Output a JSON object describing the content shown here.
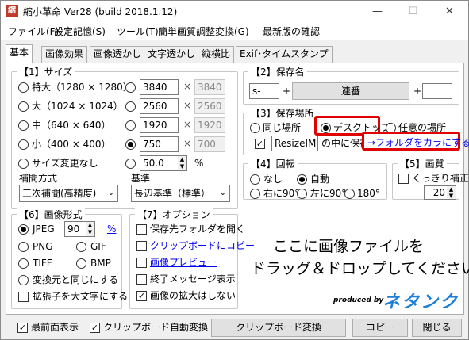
{
  "window": {
    "title": "縮小革命 Ver28  (build 2018.1.12)",
    "icon_text": "縮",
    "controls": {
      "minimize": "—",
      "maximize": "☐",
      "close": "✕"
    }
  },
  "menu": [
    "ファイル(F)",
    "設定記憶(S)",
    "ツール(T)",
    "簡単画質調整変換(G)",
    "最新版の確認"
  ],
  "tabs": [
    "基本",
    "画像効果",
    "画像透かし",
    "文字透かし",
    "縦横比",
    "Exif･タイムスタンプ"
  ],
  "size": {
    "title": "【1】サイズ",
    "presets": [
      {
        "label": "特大（1280 × 1280）",
        "selected": false
      },
      {
        "label": "大（1024 × 1024）",
        "selected": false
      },
      {
        "label": "中（640 × 640）",
        "selected": false
      },
      {
        "label": "小（400 × 400）",
        "selected": false
      },
      {
        "label": "サイズ変更なし",
        "selected": false
      }
    ],
    "custom": [
      {
        "value": "3840",
        "mirror": "3840",
        "selected": false
      },
      {
        "value": "2560",
        "mirror": "2560",
        "selected": false
      },
      {
        "value": "1920",
        "mirror": "1920",
        "selected": false
      },
      {
        "value": "750",
        "mirror": "700",
        "selected": true
      }
    ],
    "percent_value": "50.0",
    "percent_unit": "%",
    "times": "×",
    "interp_label": "補間方式",
    "interp_value": "三次補間(高精度)",
    "base_label": "基準",
    "base_value": "長辺基準（標準）"
  },
  "save_name": {
    "title": "【2】保存名",
    "prefix": "s-",
    "plus": "+",
    "middle": "連番",
    "suffix": ""
  },
  "save_location": {
    "title": "【3】保存場所",
    "options": [
      "同じ場所",
      "デスクトップ",
      "任意の場所"
    ],
    "selected": "デスクトップ",
    "folder_value": "ResizeIMG",
    "folder_suffix": "の中に保存",
    "empty_link": "→フォルダをカラにする"
  },
  "rotate": {
    "title": "【4】回転",
    "options": [
      "なし",
      "自動",
      "右に90°",
      "左に90°",
      "180°"
    ],
    "selected": "自動"
  },
  "quality": {
    "title": "【5】画質",
    "sharpen_label": "くっきり補正",
    "value": "20"
  },
  "format": {
    "title": "【6】画像形式",
    "jpeg_label": "JPEG",
    "jpeg_quality": "90",
    "percent_link": "%",
    "png": "PNG",
    "gif": "GIF",
    "tiff": "TIFF",
    "bmp": "BMP",
    "same_label": "変換元と同じにする",
    "upper_ext_label": "拡張子を大文字にする"
  },
  "options": {
    "title": "【7】オプション",
    "open_folder": "保存先フォルダを開く",
    "clipboard_copy": "クリップボードにコピー",
    "preview": "画像プレビュー",
    "end_message": "終了メッセージ表示",
    "no_enlarge": "画像の拡大はしない"
  },
  "drop_area": {
    "line1": "ここに画像ファイルを",
    "line2": "ドラッグ＆ドロップしてください",
    "produced_by": "produced by",
    "logo": "ネタンク"
  },
  "bottom": {
    "topmost_label": "最前面表示",
    "clip_auto_label": "クリップボード自動変換",
    "clip_convert_button": "クリップボード変換",
    "copy_button": "コピー",
    "close_button": "閉じる"
  },
  "colors": {
    "highlight_box": "#e00000",
    "link": "#0000ee",
    "logo": "#1e7fd6"
  }
}
